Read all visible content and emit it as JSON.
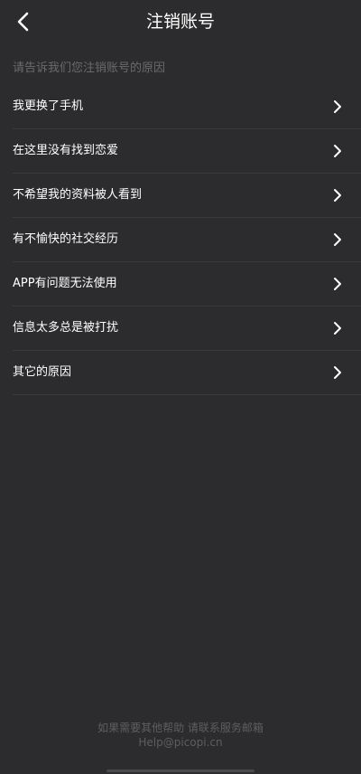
{
  "header": {
    "title": "注销账号",
    "back_icon": "chevron-left-icon"
  },
  "prompt": "请告诉我们您注销账号的原因",
  "reasons": [
    {
      "label": "我更换了手机"
    },
    {
      "label": "在这里没有找到恋爱"
    },
    {
      "label": "不希望我的资料被人看到"
    },
    {
      "label": "有不愉快的社交经历"
    },
    {
      "label": "APP有问题无法使用"
    },
    {
      "label": "信息太多总是被打扰"
    },
    {
      "label": "其它的原因"
    }
  ],
  "footer": {
    "line1": "如果需要其他帮助 请联系服务邮箱",
    "line2": "Help@picopi.cn"
  },
  "colors": {
    "background": "#2c2c2e",
    "divider": "#3a3a3d",
    "muted_text": "#6a6a6e"
  }
}
